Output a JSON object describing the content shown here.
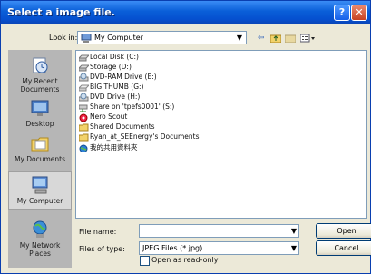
{
  "window": {
    "title": "Select a image file."
  },
  "lookin": {
    "label": "Look in:",
    "value": "My Computer"
  },
  "places": [
    {
      "label": "My Recent\nDocuments",
      "icon": "recent-documents-icon"
    },
    {
      "label": "Desktop",
      "icon": "desktop-icon"
    },
    {
      "label": "My Documents",
      "icon": "my-documents-icon"
    },
    {
      "label": "My Computer",
      "icon": "my-computer-icon"
    },
    {
      "label": "My Network\nPlaces",
      "icon": "network-places-icon"
    }
  ],
  "files": [
    {
      "label": "Local Disk (C:)",
      "icon": "hard-drive-icon"
    },
    {
      "label": "Storage (D:)",
      "icon": "hard-drive-icon"
    },
    {
      "label": "DVD-RAM Drive (E:)",
      "icon": "dvd-drive-icon"
    },
    {
      "label": "BIG THUMB (G:)",
      "icon": "removable-drive-icon"
    },
    {
      "label": "DVD Drive (H:)",
      "icon": "dvd-drive-icon"
    },
    {
      "label": "Share on 'tpefs0001' (S:)",
      "icon": "network-drive-icon"
    },
    {
      "label": "Nero Scout",
      "icon": "nero-scout-icon"
    },
    {
      "label": "Shared Documents",
      "icon": "folder-icon"
    },
    {
      "label": "Ryan_at_SEEnergy's Documents",
      "icon": "folder-icon"
    },
    {
      "label": "我的共用資料夾",
      "icon": "shared-folder-icon"
    }
  ],
  "filename": {
    "label": "File name:",
    "value": ""
  },
  "filetype": {
    "label": "Files of type:",
    "value": "JPEG Files (*.jpg)"
  },
  "readonly": {
    "label": "Open as read-only"
  },
  "buttons": {
    "open": "Open",
    "cancel": "Cancel"
  }
}
